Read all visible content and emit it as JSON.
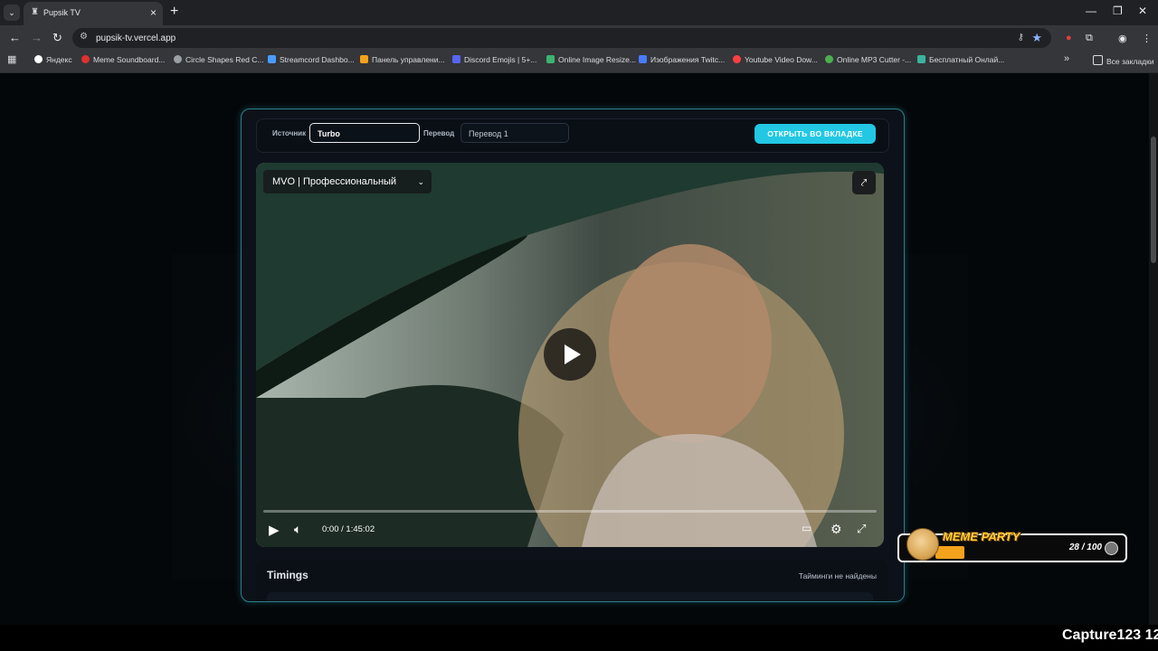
{
  "browser": {
    "tab_title": "Pupsik TV",
    "url": "pupsik-tv.vercel.app",
    "bookmarks": [
      {
        "label": "Яндекс",
        "color": "#ffffff"
      },
      {
        "label": "Meme Soundboard...",
        "color": "#e03030"
      },
      {
        "label": "Circle Shapes Red C...",
        "color": "#9aa0a6"
      },
      {
        "label": "Streamcord Dashbo...",
        "color": "#4a9bff"
      },
      {
        "label": "Панель управлени...",
        "color": "#f6a21c"
      },
      {
        "label": "Discord Emojis | 5+...",
        "color": "#5865f2"
      },
      {
        "label": "Online Image Resize...",
        "color": "#3cb371"
      },
      {
        "label": "Изображения Twitc...",
        "color": "#4a7bff"
      },
      {
        "label": "Youtube Video Dow...",
        "color": "#ff4040"
      },
      {
        "label": "Online MP3 Cutter -...",
        "color": "#4caf50"
      },
      {
        "label": "Бесплатный Онлай...",
        "color": "#3cb3a0"
      }
    ],
    "all_bookmarks": "Все закладки"
  },
  "player_controls": {
    "source_label": "Источник",
    "source_value": "Turbo",
    "translation_label": "Перевод",
    "translation_value": "Перевод 1",
    "open_in_tab": "ОТКРЫТЬ ВО ВКЛАДКЕ"
  },
  "video": {
    "quality_label": "MVO | Профессиональный",
    "time_current": "0:00",
    "time_separator": "/",
    "time_total": "1:45:02",
    "progress": 0
  },
  "timings": {
    "title": "Timings",
    "status": "Тайминги не найдены"
  },
  "overlay": {
    "meme_title": "MEME PARTY",
    "meme_count": "28 / 100",
    "capture_text": "Capture123 12"
  },
  "colors": {
    "accent": "#22c8e3",
    "card_border": "#2b7f8a"
  }
}
